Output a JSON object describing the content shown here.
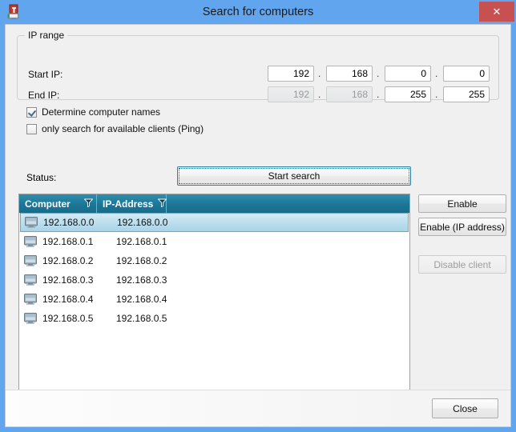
{
  "window": {
    "title": "Search for computers",
    "icon": "shield-computer-icon",
    "close_label": "✕",
    "frame_color": "#62a5ef",
    "close_button_color": "#c75050"
  },
  "ip_range": {
    "group_label": "IP range",
    "start_label": "Start IP:",
    "end_label": "End IP:",
    "separator": ".",
    "start_octets": [
      {
        "value": "192",
        "enabled": true
      },
      {
        "value": "168",
        "enabled": true
      },
      {
        "value": "0",
        "enabled": true
      },
      {
        "value": "0",
        "enabled": true
      }
    ],
    "end_octets": [
      {
        "value": "192",
        "enabled": false
      },
      {
        "value": "168",
        "enabled": false
      },
      {
        "value": "255",
        "enabled": true
      },
      {
        "value": "255",
        "enabled": true
      }
    ]
  },
  "options": {
    "determine_names": {
      "label": "Determine computer names",
      "checked": true
    },
    "ping_only": {
      "label": "only search for available clients (Ping)",
      "checked": false
    }
  },
  "status": {
    "label": "Status:",
    "value": "",
    "start_button": "Start search"
  },
  "list": {
    "columns": [
      {
        "label": "Computer",
        "filter": true
      },
      {
        "label": "IP-Address",
        "filter": true
      }
    ],
    "header_color": "#1d7696",
    "selection_color": "#a8d4e8",
    "rows": [
      {
        "computer": "192.168.0.0",
        "ip": "192.168.0.0",
        "selected": true
      },
      {
        "computer": "192.168.0.1",
        "ip": "192.168.0.1",
        "selected": false
      },
      {
        "computer": "192.168.0.2",
        "ip": "192.168.0.2",
        "selected": false
      },
      {
        "computer": "192.168.0.3",
        "ip": "192.168.0.3",
        "selected": false
      },
      {
        "computer": "192.168.0.4",
        "ip": "192.168.0.4",
        "selected": false
      },
      {
        "computer": "192.168.0.5",
        "ip": "192.168.0.5",
        "selected": false
      }
    ]
  },
  "side_buttons": {
    "enable": {
      "label": "Enable",
      "enabled": true
    },
    "enable_ip": {
      "label": "Enable (IP address)",
      "enabled": true
    },
    "disable": {
      "label": "Disable client",
      "enabled": false
    }
  },
  "footer": {
    "close": "Close"
  }
}
